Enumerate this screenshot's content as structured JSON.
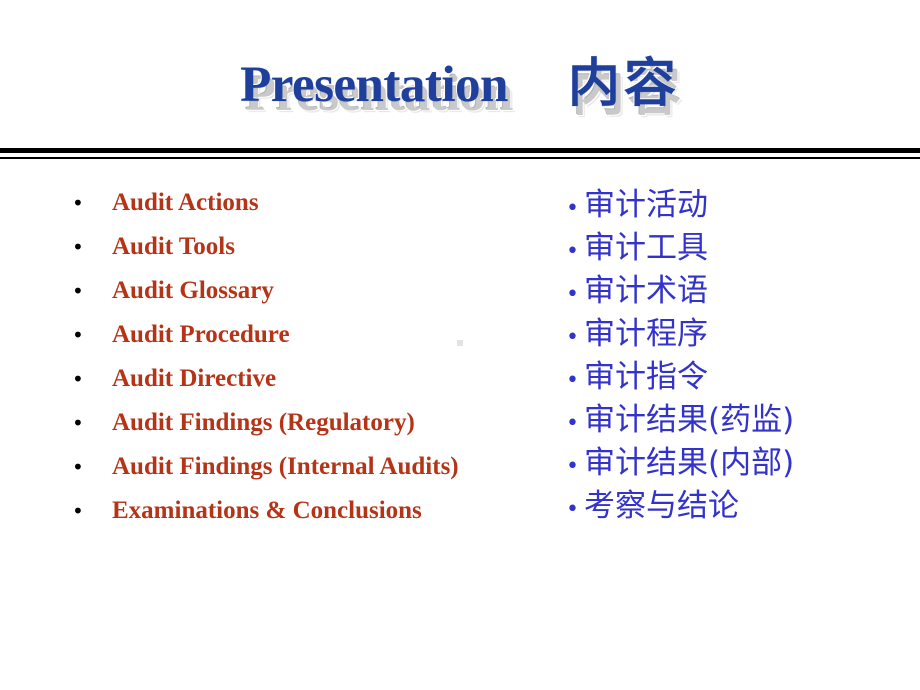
{
  "slide": {
    "background_color": "#ffffff",
    "title": {
      "english": "Presentation",
      "chinese": "内容",
      "text_color": "#1f3f9c",
      "shadow_color": "#c9c9c9"
    },
    "divider": {
      "color": "#000000",
      "style": "double-rule"
    },
    "left_column": {
      "text_color": "#b53417",
      "bullet_color": "#000000",
      "bullet_glyph": "•",
      "items": [
        {
          "label": "Audit Actions"
        },
        {
          "label": "Audit Tools"
        },
        {
          "label": "Audit Glossary"
        },
        {
          "label": "Audit Procedure"
        },
        {
          "label": "Audit Directive"
        },
        {
          "label": "Audit Findings (Regulatory)"
        },
        {
          "label": "Audit Findings (Internal Audits)"
        },
        {
          "label": "Examinations & Conclusions"
        }
      ]
    },
    "right_column": {
      "text_color": "#3333cc",
      "bullet_color": "#3333cc",
      "bullet_glyph": "•",
      "items": [
        {
          "label": "审计活动"
        },
        {
          "label": "审计工具"
        },
        {
          "label": "审计术语"
        },
        {
          "label": "审计程序"
        },
        {
          "label": "审计指令"
        },
        {
          "label": "审计结果(药监)"
        },
        {
          "label": "审计结果(内部)"
        },
        {
          "label": "考察与结论"
        }
      ]
    }
  }
}
